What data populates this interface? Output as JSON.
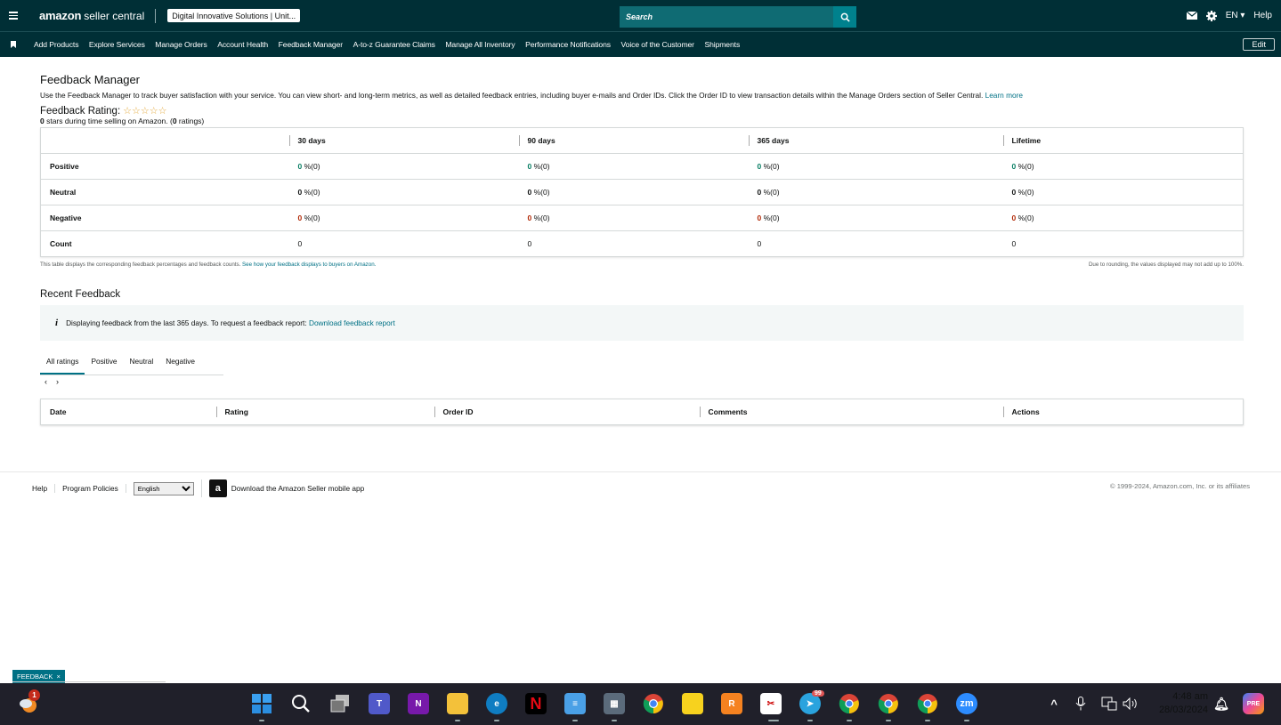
{
  "topbar": {
    "brand_amazon": "amazon",
    "brand_seller": "seller central",
    "account": "Digital Innovative Solutions | Unit...",
    "search_placeholder": "Search",
    "lang": "EN",
    "help": "Help"
  },
  "nav": {
    "items": [
      "Add Products",
      "Explore Services",
      "Manage Orders",
      "Account Health",
      "Feedback Manager",
      "A-to-z Guarantee Claims",
      "Manage All Inventory",
      "Performance Notifications",
      "Voice of the Customer",
      "Shipments"
    ],
    "edit": "Edit"
  },
  "page": {
    "title": "Feedback Manager",
    "description": "Use the Feedback Manager to track buyer satisfaction with your service. You can view short- and long-term metrics, as well as detailed feedback entries, including buyer e-mails and Order IDs. Click the Order ID to view transaction details within the Manage Orders section of Seller Central.",
    "learn_more": "Learn more",
    "rating_label": "Feedback Rating:",
    "stars_text": "☆☆☆☆☆",
    "stars_count": "0",
    "stars_sub_a": " stars during time selling on Amazon. (",
    "ratings_count": "0",
    "stars_sub_b": " ratings)"
  },
  "metrics": {
    "columns": [
      "30 days",
      "90 days",
      "365 days",
      "Lifetime"
    ],
    "rows": [
      {
        "label": "Positive",
        "cells": [
          {
            "v": "0",
            "s": " %(0)"
          },
          {
            "v": "0",
            "s": " %(0)"
          },
          {
            "v": "0",
            "s": " %(0)"
          },
          {
            "v": "0",
            "s": " %(0)"
          }
        ]
      },
      {
        "label": "Neutral",
        "cells": [
          {
            "v": "0",
            "s": " %(0)"
          },
          {
            "v": "0",
            "s": " %(0)"
          },
          {
            "v": "0",
            "s": " %(0)"
          },
          {
            "v": "0",
            "s": " %(0)"
          }
        ]
      },
      {
        "label": "Negative",
        "cells": [
          {
            "v": "0",
            "s": " %(0)"
          },
          {
            "v": "0",
            "s": " %(0)"
          },
          {
            "v": "0",
            "s": " %(0)"
          },
          {
            "v": "0",
            "s": " %(0)"
          }
        ]
      },
      {
        "label": "Count",
        "cells": [
          {
            "v": "0",
            "s": ""
          },
          {
            "v": "0",
            "s": ""
          },
          {
            "v": "0",
            "s": ""
          },
          {
            "v": "0",
            "s": ""
          }
        ]
      }
    ],
    "note_left": "This table displays the corresponding feedback percentages and feedback counts.",
    "note_link": "See how your feedback displays to buyers on Amazon.",
    "note_right": "Due to rounding, the values displayed may not add up to 100%."
  },
  "recent": {
    "title": "Recent Feedback",
    "info": "Displaying feedback from the last 365 days. To request a feedback report:",
    "info_link": "Download feedback report",
    "tabs": [
      "All ratings",
      "Positive",
      "Neutral",
      "Negative"
    ],
    "pager_prev": "‹",
    "pager_next": "›",
    "columns": [
      "Date",
      "Rating",
      "Order ID",
      "Comments",
      "Actions"
    ]
  },
  "footer": {
    "help": "Help",
    "policies": "Program Policies",
    "language": "English",
    "app": "Download the Amazon Seller mobile app",
    "copyright": "© 1999-2024, Amazon.com, Inc. or its affiliates"
  },
  "feedback_tab": {
    "label": "FEEDBACK",
    "close": "×"
  },
  "taskbar": {
    "time": "4:48 am",
    "date": "28/03/2024",
    "weather_badge": "1",
    "telegram_badge": "99"
  },
  "colors": {
    "header": "#002f36",
    "positive": "#067d62",
    "negative": "#b12704",
    "link": "#007185"
  }
}
